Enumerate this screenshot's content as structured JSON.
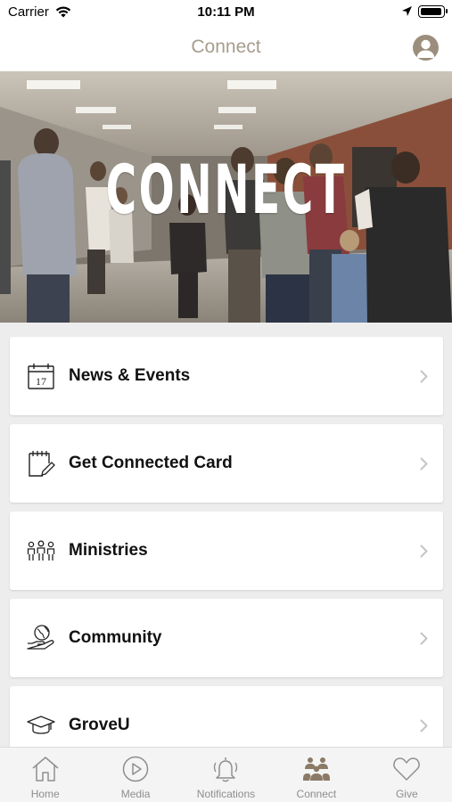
{
  "status_bar": {
    "carrier": "Carrier",
    "time": "10:11 PM"
  },
  "nav": {
    "title": "Connect"
  },
  "hero": {
    "text": "CONNECT"
  },
  "menu": [
    {
      "label": "News & Events",
      "icon": "calendar-icon",
      "calendar_day": "17"
    },
    {
      "label": "Get Connected Card",
      "icon": "notepad-edit-icon"
    },
    {
      "label": "Ministries",
      "icon": "people-group-icon"
    },
    {
      "label": "Community",
      "icon": "globe-hand-icon"
    },
    {
      "label": "GroveU",
      "icon": "graduation-cap-icon"
    }
  ],
  "tabs": [
    {
      "label": "Home",
      "icon": "home-icon"
    },
    {
      "label": "Media",
      "icon": "play-icon"
    },
    {
      "label": "Notifications",
      "icon": "bell-icon"
    },
    {
      "label": "Connect",
      "icon": "people-icon",
      "active": true
    },
    {
      "label": "Give",
      "icon": "heart-icon"
    }
  ],
  "colors": {
    "accent": "#a89d8d",
    "icon_active": "#8b7a66",
    "icon_inactive": "#8e8e8e"
  }
}
